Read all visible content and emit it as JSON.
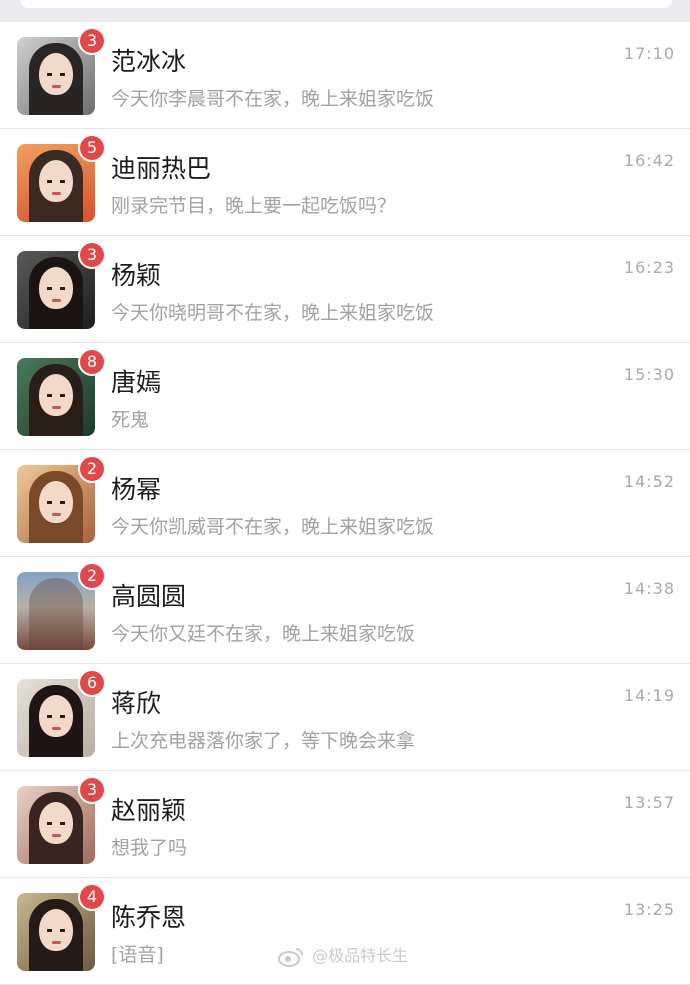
{
  "chats": [
    {
      "name": "范冰冰",
      "preview": "今天你李晨哥不在家，晚上来姐家吃饭",
      "time": "17:10",
      "unread": "3"
    },
    {
      "name": "迪丽热巴",
      "preview": "刚录完节目，晚上要一起吃饭吗？",
      "time": "16:42",
      "unread": "5"
    },
    {
      "name": "杨颖",
      "preview": "今天你晓明哥不在家，晚上来姐家吃饭",
      "time": "16:23",
      "unread": "3"
    },
    {
      "name": "唐嫣",
      "preview": "死鬼",
      "time": "15:30",
      "unread": "8"
    },
    {
      "name": "杨幂",
      "preview": "今天你凯威哥不在家，晚上来姐家吃饭",
      "time": "14:52",
      "unread": "2"
    },
    {
      "name": "高圆圆",
      "preview": "今天你又廷不在家，晚上来姐家吃饭",
      "time": "14:38",
      "unread": "2"
    },
    {
      "name": "蒋欣",
      "preview": "上次充电器落你家了，等下晚会来拿",
      "time": "14:19",
      "unread": "6"
    },
    {
      "name": "赵丽颖",
      "preview": "想我了吗",
      "time": "13:57",
      "unread": "3"
    },
    {
      "name": "陈乔恩",
      "preview": "[语音]",
      "time": "13:25",
      "unread": "4"
    }
  ],
  "watermark": "@极品特长生",
  "colors": {
    "badge": "#e2474a",
    "name_text": "#1c1c1c",
    "preview_text": "#a2a2a2",
    "time_text": "#a9a9a9",
    "background": "#f0eff4"
  }
}
